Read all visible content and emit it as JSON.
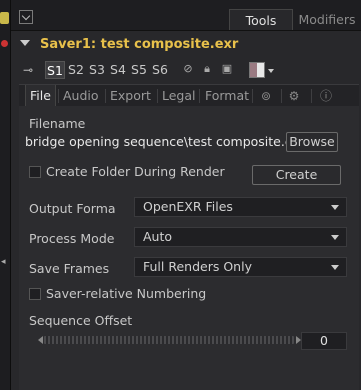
{
  "window": {
    "tabs": [
      "Tools",
      "Modifiers"
    ],
    "active_tab": "Tools"
  },
  "tool": {
    "title": "Saver1: test composite.exr",
    "slots": [
      "S1",
      "S2",
      "S3",
      "S4",
      "S5",
      "S6"
    ],
    "active_slot": "S1",
    "icons": [
      "pin-icon",
      "disable-icon",
      "lock-icon",
      "save-icon",
      "color-swatch",
      "chevron-down-icon"
    ]
  },
  "subtabs": {
    "labels": [
      "File",
      "Audio",
      "Export",
      "Legal",
      "Format"
    ],
    "active": "File",
    "icons": [
      "film-icon",
      "gear-icon",
      "info-icon"
    ]
  },
  "form": {
    "filename_label": "Filename",
    "filename_value": "bridge opening sequence\\test composite.exr",
    "browse_label": "Browse",
    "create_folder_label": "Create Folder During Render",
    "create_label": "Create",
    "output_format_label": "Output Forma",
    "output_format_value": "OpenEXR Files",
    "process_mode_label": "Process Mode",
    "process_mode_value": "Auto",
    "save_frames_label": "Save Frames",
    "save_frames_value": "Full Renders Only",
    "saver_relative_label": "Saver-relative Numbering",
    "sequence_offset_label": "Sequence Offset",
    "sequence_offset_value": "0"
  }
}
